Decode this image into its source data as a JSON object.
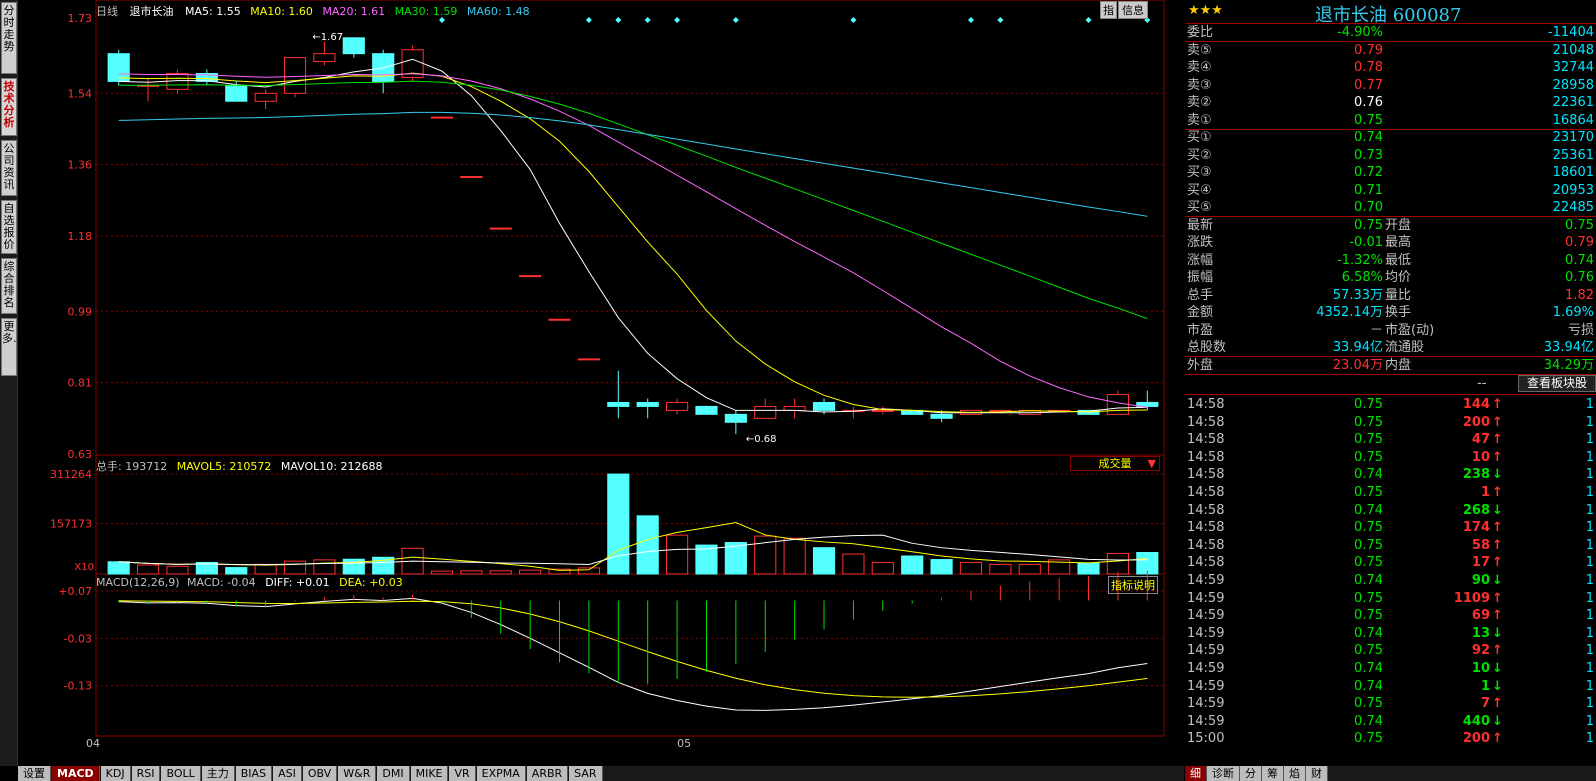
{
  "left_tabs": [
    "分时走势",
    "技术分析",
    "公司资讯",
    "自选报价",
    "综合排名",
    "更多…"
  ],
  "header": {
    "period": "日线",
    "stock": "退市长油",
    "ma5": "MA5: 1.55",
    "ma10": "MA10: 1.60",
    "ma20": "MA20: 1.61",
    "ma30": "MA30: 1.59",
    "ma60": "MA60: 1.48",
    "btn_zhi": "指",
    "btn_info": "信息"
  },
  "price_axis": [
    "1.73",
    "1.54",
    "1.36",
    "1.18",
    "0.99",
    "0.81",
    "0.63"
  ],
  "price_annot": {
    "high": "1.67",
    "low": "0.68"
  },
  "vol_header": {
    "total": "总手: 193712",
    "mavol5": "MAVOL5: 210572",
    "mavol10": "MAVOL10: 212688",
    "dropdown": "成交量"
  },
  "vol_axis": [
    "311264",
    "157173",
    "X10"
  ],
  "macd_header": {
    "label": "MACD(12,26,9)",
    "macd": "MACD: -0.04",
    "diff": "DIFF: +0.01",
    "dea": "DEA: +0.03",
    "btn": "指标说明"
  },
  "macd_axis": [
    "+0.07",
    "-0.03",
    "-0.13"
  ],
  "date_axis": [
    "04",
    "05"
  ],
  "bottom_tabs": [
    "设置",
    "MACD",
    "KDJ",
    "RSI",
    "BOLL",
    "主力",
    "BIAS",
    "ASI",
    "OBV",
    "W&R",
    "DMI",
    "MIKE",
    "VR",
    "EXPMA",
    "ARBR",
    "SAR"
  ],
  "quote": {
    "stars": "★★★",
    "title": "退市长油 600087",
    "weibi_label": "委比",
    "weibi_pct": "-4.90%",
    "weibi_diff": "-11404",
    "sells": [
      {
        "l": "卖⑤",
        "p": "0.79",
        "v": "21048"
      },
      {
        "l": "卖④",
        "p": "0.78",
        "v": "32744"
      },
      {
        "l": "卖③",
        "p": "0.77",
        "v": "28958"
      },
      {
        "l": "卖②",
        "p": "0.76",
        "v": "22361"
      },
      {
        "l": "卖①",
        "p": "0.75",
        "v": "16864"
      }
    ],
    "buys": [
      {
        "l": "买①",
        "p": "0.74",
        "v": "23170"
      },
      {
        "l": "买②",
        "p": "0.73",
        "v": "25361"
      },
      {
        "l": "买③",
        "p": "0.72",
        "v": "18601"
      },
      {
        "l": "买④",
        "p": "0.71",
        "v": "20953"
      },
      {
        "l": "买⑤",
        "p": "0.70",
        "v": "22485"
      }
    ],
    "stats": [
      {
        "l1": "最新",
        "v1": "0.75",
        "l2": "开盘",
        "v2": "0.75"
      },
      {
        "l1": "涨跌",
        "v1": "-0.01",
        "l2": "最高",
        "v2": "0.79"
      },
      {
        "l1": "涨幅",
        "v1": "-1.32%",
        "l2": "最低",
        "v2": "0.74"
      },
      {
        "l1": "振幅",
        "v1": "6.58%",
        "l2": "均价",
        "v2": "0.76"
      },
      {
        "l1": "总手",
        "v1": "57.33万",
        "l2": "量比",
        "v2": "1.82"
      },
      {
        "l1": "金额",
        "v1": "4352.14万",
        "l2": "换手",
        "v2": "1.69%"
      },
      {
        "l1": "市盈",
        "v1": "－",
        "l2": "市盈(动)",
        "v2": "亏损"
      },
      {
        "l1": "总股数",
        "v1": "33.94亿",
        "l2": "流通股",
        "v2": "33.94亿"
      },
      {
        "l1": "外盘",
        "v1": "23.04万",
        "l2": "内盘",
        "v2": "34.29万"
      }
    ],
    "block_btn_prefix": "--",
    "block_btn": "查看板块股"
  },
  "ticks": [
    {
      "t": "14:58",
      "p": "0.75",
      "v": "144",
      "d": "up",
      "n": "1"
    },
    {
      "t": "14:58",
      "p": "0.75",
      "v": "200",
      "d": "up",
      "n": "1"
    },
    {
      "t": "14:58",
      "p": "0.75",
      "v": "47",
      "d": "up",
      "n": "1"
    },
    {
      "t": "14:58",
      "p": "0.75",
      "v": "10",
      "d": "up",
      "n": "1"
    },
    {
      "t": "14:58",
      "p": "0.74",
      "v": "238",
      "d": "down",
      "n": "1"
    },
    {
      "t": "14:58",
      "p": "0.75",
      "v": "1",
      "d": "up",
      "n": "1"
    },
    {
      "t": "14:58",
      "p": "0.74",
      "v": "268",
      "d": "down",
      "n": "1"
    },
    {
      "t": "14:58",
      "p": "0.75",
      "v": "174",
      "d": "up",
      "n": "1"
    },
    {
      "t": "14:58",
      "p": "0.75",
      "v": "58",
      "d": "up",
      "n": "1"
    },
    {
      "t": "14:58",
      "p": "0.75",
      "v": "17",
      "d": "up",
      "n": "1"
    },
    {
      "t": "14:59",
      "p": "0.74",
      "v": "90",
      "d": "down",
      "n": "1"
    },
    {
      "t": "14:59",
      "p": "0.75",
      "v": "1109",
      "d": "up",
      "n": "1"
    },
    {
      "t": "14:59",
      "p": "0.75",
      "v": "69",
      "d": "up",
      "n": "1"
    },
    {
      "t": "14:59",
      "p": "0.74",
      "v": "13",
      "d": "down",
      "n": "1"
    },
    {
      "t": "14:59",
      "p": "0.75",
      "v": "92",
      "d": "up",
      "n": "1"
    },
    {
      "t": "14:59",
      "p": "0.74",
      "v": "10",
      "d": "down",
      "n": "1"
    },
    {
      "t": "14:59",
      "p": "0.74",
      "v": "1",
      "d": "down",
      "n": "1"
    },
    {
      "t": "14:59",
      "p": "0.75",
      "v": "7",
      "d": "up",
      "n": "1"
    },
    {
      "t": "14:59",
      "p": "0.74",
      "v": "440",
      "d": "down",
      "n": "1"
    },
    {
      "t": "15:00",
      "p": "0.75",
      "v": "200",
      "d": "up",
      "n": "1"
    }
  ],
  "right_bottom_tabs": [
    "细",
    "诊断",
    "分",
    "筹",
    "焰",
    "财"
  ],
  "colors": {
    "up": "#ff3030",
    "down": "#00e0e0",
    "flat": "#ffffff",
    "label": "#c0c0c0",
    "cyan": "#00e5ff",
    "green": "#00e000",
    "red": "#ff3030",
    "yellow": "#ffff00",
    "magenta": "#ff66ff",
    "teal": "#33ccee",
    "grid": "#8b0000"
  },
  "chart_data": {
    "type": "candlestick",
    "candles": [
      {
        "o": 1.64,
        "c": 1.57,
        "h": 1.65,
        "l": 1.56
      },
      {
        "o": 1.56,
        "c": 1.56,
        "h": 1.58,
        "l": 1.52
      },
      {
        "o": 1.55,
        "c": 1.59,
        "h": 1.6,
        "l": 1.54
      },
      {
        "o": 1.59,
        "c": 1.57,
        "h": 1.6,
        "l": 1.56
      },
      {
        "o": 1.56,
        "c": 1.52,
        "h": 1.57,
        "l": 1.52
      },
      {
        "o": 1.52,
        "c": 1.54,
        "h": 1.55,
        "l": 1.5
      },
      {
        "o": 1.54,
        "c": 1.63,
        "h": 1.63,
        "l": 1.53
      },
      {
        "o": 1.62,
        "c": 1.64,
        "h": 1.67,
        "l": 1.61
      },
      {
        "o": 1.68,
        "c": 1.64,
        "h": 1.68,
        "l": 1.63
      },
      {
        "o": 1.64,
        "c": 1.57,
        "h": 1.65,
        "l": 1.54
      },
      {
        "o": 1.58,
        "c": 1.65,
        "h": 1.66,
        "l": 1.57
      },
      {
        "o": 1.48,
        "c": 1.48,
        "h": 1.48,
        "l": 1.48
      },
      {
        "o": 1.33,
        "c": 1.33,
        "h": 1.33,
        "l": 1.33
      },
      {
        "o": 1.2,
        "c": 1.2,
        "h": 1.2,
        "l": 1.2
      },
      {
        "o": 1.08,
        "c": 1.08,
        "h": 1.08,
        "l": 1.08
      },
      {
        "o": 0.97,
        "c": 0.97,
        "h": 0.97,
        "l": 0.97
      },
      {
        "o": 0.87,
        "c": 0.87,
        "h": 0.87,
        "l": 0.87
      },
      {
        "o": 0.76,
        "c": 0.75,
        "h": 0.84,
        "l": 0.72
      },
      {
        "o": 0.76,
        "c": 0.75,
        "h": 0.77,
        "l": 0.72
      },
      {
        "o": 0.74,
        "c": 0.76,
        "h": 0.77,
        "l": 0.73
      },
      {
        "o": 0.75,
        "c": 0.73,
        "h": 0.75,
        "l": 0.73
      },
      {
        "o": 0.73,
        "c": 0.71,
        "h": 0.74,
        "l": 0.68
      },
      {
        "o": 0.72,
        "c": 0.75,
        "h": 0.77,
        "l": 0.72
      },
      {
        "o": 0.74,
        "c": 0.75,
        "h": 0.77,
        "l": 0.72
      },
      {
        "o": 0.76,
        "c": 0.74,
        "h": 0.77,
        "l": 0.73
      },
      {
        "o": 0.74,
        "c": 0.74,
        "h": 0.75,
        "l": 0.72
      },
      {
        "o": 0.74,
        "c": 0.74,
        "h": 0.75,
        "l": 0.73
      },
      {
        "o": 0.74,
        "c": 0.73,
        "h": 0.74,
        "l": 0.73
      },
      {
        "o": 0.73,
        "c": 0.72,
        "h": 0.74,
        "l": 0.71
      },
      {
        "o": 0.73,
        "c": 0.74,
        "h": 0.74,
        "l": 0.73
      },
      {
        "o": 0.74,
        "c": 0.74,
        "h": 0.74,
        "l": 0.74
      },
      {
        "o": 0.73,
        "c": 0.74,
        "h": 0.74,
        "l": 0.73
      },
      {
        "o": 0.74,
        "c": 0.74,
        "h": 0.74,
        "l": 0.74
      },
      {
        "o": 0.74,
        "c": 0.73,
        "h": 0.74,
        "l": 0.73
      },
      {
        "o": 0.73,
        "c": 0.78,
        "h": 0.79,
        "l": 0.73
      },
      {
        "o": 0.76,
        "c": 0.75,
        "h": 0.79,
        "l": 0.74
      }
    ],
    "volumes": [
      38,
      28,
      24,
      36,
      20,
      30,
      40,
      44,
      46,
      52,
      80,
      9,
      10,
      10,
      12,
      15,
      19,
      311,
      181,
      121,
      90,
      98,
      118,
      111,
      82,
      62,
      36,
      56,
      45,
      36,
      30,
      30,
      44,
      34,
      64,
      67
    ],
    "vol_max": 311264,
    "ma_series": [
      {
        "name": "MA5",
        "color": "#ffffff"
      },
      {
        "name": "MA10",
        "color": "#ffff00"
      },
      {
        "name": "MA20",
        "color": "#ff66ff"
      },
      {
        "name": "MA30",
        "color": "#00e000"
      },
      {
        "name": "MA60",
        "color": "#33ccee"
      }
    ],
    "ylim": [
      0.63,
      1.73
    ],
    "macd_ylim": [
      -0.23,
      0.07
    ],
    "x_ticks": [
      {
        "label": "04",
        "index": 0
      },
      {
        "label": "05",
        "index": 19
      }
    ]
  }
}
